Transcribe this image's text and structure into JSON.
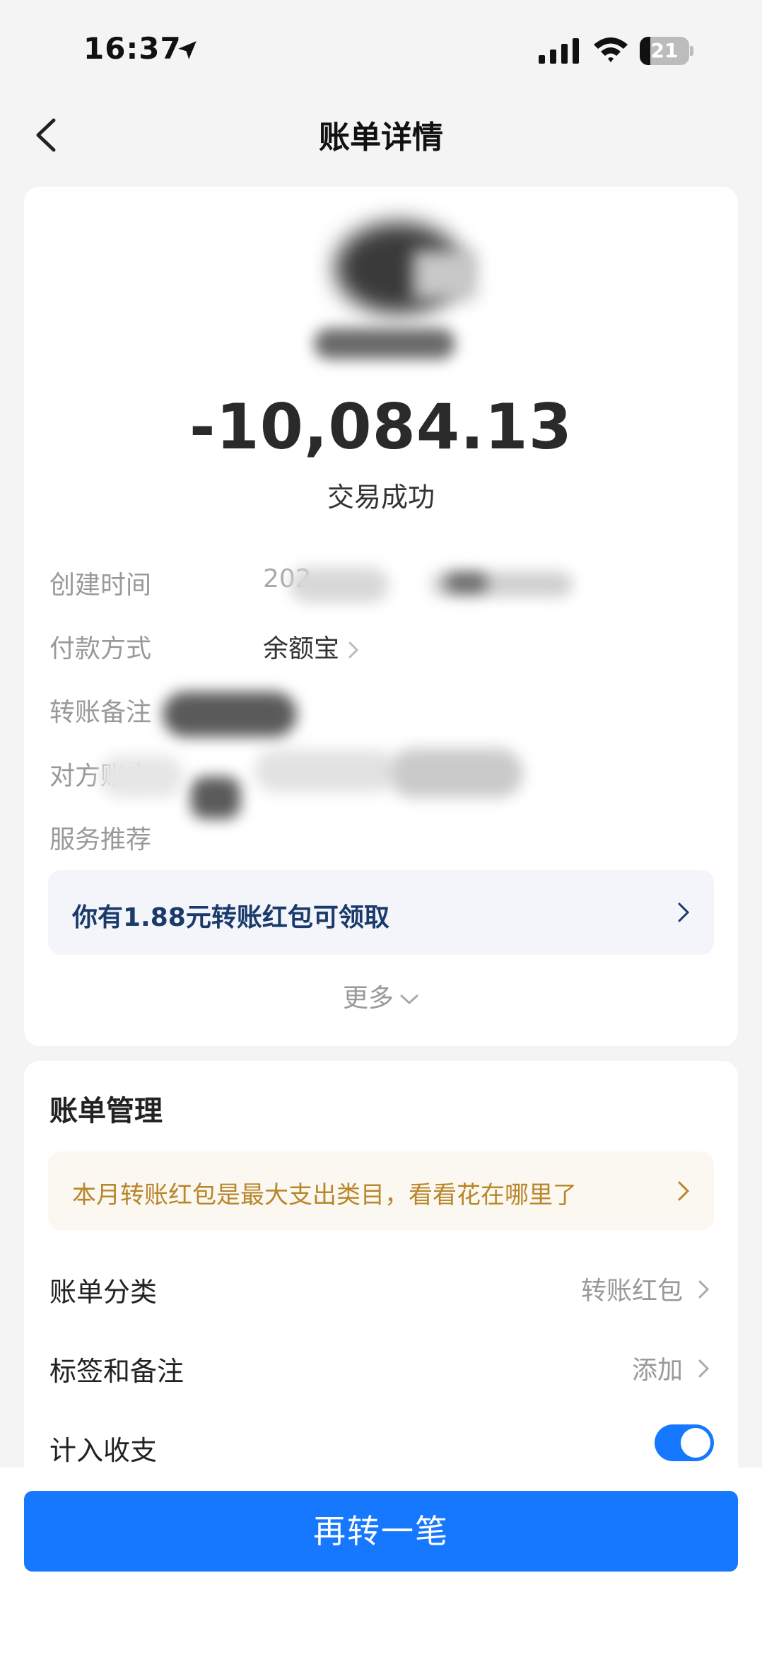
{
  "status_bar": {
    "time": "16:37",
    "battery_level": "21",
    "battery_fraction": 0.21,
    "icons": [
      "location-arrow-icon",
      "signal-icon",
      "wifi-icon",
      "battery-icon"
    ]
  },
  "nav": {
    "title": "账单详情",
    "back_icon": "chevron-left-icon"
  },
  "transaction": {
    "amount": "-10,084.13",
    "status": "交易成功"
  },
  "details": {
    "created_time_label": "创建时间",
    "created_time_value": "202",
    "payment_method_label": "付款方式",
    "payment_method_value": "余额宝",
    "transfer_note_label": "转账备注",
    "counterparty_label": "对方账户",
    "service_label": "服务推荐"
  },
  "promo": {
    "text": "你有1.88元转账红包可领取"
  },
  "more": {
    "label": "更多"
  },
  "bill_management": {
    "title": "账单管理",
    "tip": "本月转账红包是最大支出类目，看看花在哪里了",
    "category_label": "账单分类",
    "category_value": "转账红包",
    "tags_label": "标签和备注",
    "tags_value": "添加",
    "include_label": "计入收支",
    "include_on": true
  },
  "action": {
    "primary_label": "再转一笔"
  },
  "colors": {
    "accent": "#1677ff",
    "promo_text": "#1a3a6b",
    "tip_text": "#b8862b",
    "background": "#f4f4f4"
  }
}
